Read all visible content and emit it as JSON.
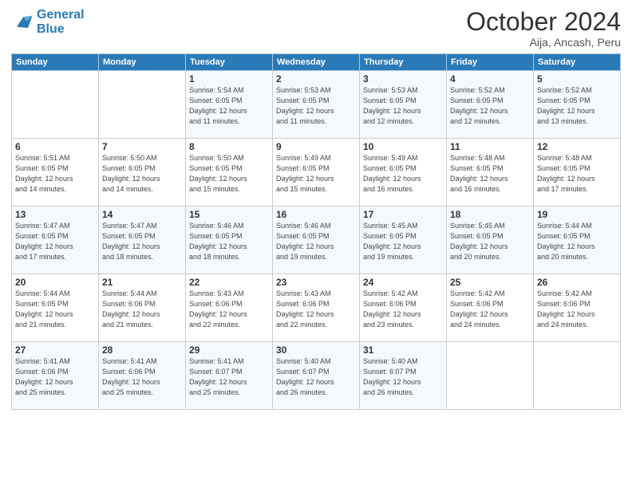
{
  "logo": {
    "line1": "General",
    "line2": "Blue"
  },
  "title": "October 2024",
  "subtitle": "Aija, Ancash, Peru",
  "days_of_week": [
    "Sunday",
    "Monday",
    "Tuesday",
    "Wednesday",
    "Thursday",
    "Friday",
    "Saturday"
  ],
  "weeks": [
    [
      {
        "num": "",
        "detail": ""
      },
      {
        "num": "",
        "detail": ""
      },
      {
        "num": "1",
        "detail": "Sunrise: 5:54 AM\nSunset: 6:05 PM\nDaylight: 12 hours\nand 11 minutes."
      },
      {
        "num": "2",
        "detail": "Sunrise: 5:53 AM\nSunset: 6:05 PM\nDaylight: 12 hours\nand 11 minutes."
      },
      {
        "num": "3",
        "detail": "Sunrise: 5:53 AM\nSunset: 6:05 PM\nDaylight: 12 hours\nand 12 minutes."
      },
      {
        "num": "4",
        "detail": "Sunrise: 5:52 AM\nSunset: 6:05 PM\nDaylight: 12 hours\nand 12 minutes."
      },
      {
        "num": "5",
        "detail": "Sunrise: 5:52 AM\nSunset: 6:05 PM\nDaylight: 12 hours\nand 13 minutes."
      }
    ],
    [
      {
        "num": "6",
        "detail": "Sunrise: 5:51 AM\nSunset: 6:05 PM\nDaylight: 12 hours\nand 14 minutes."
      },
      {
        "num": "7",
        "detail": "Sunrise: 5:50 AM\nSunset: 6:05 PM\nDaylight: 12 hours\nand 14 minutes."
      },
      {
        "num": "8",
        "detail": "Sunrise: 5:50 AM\nSunset: 6:05 PM\nDaylight: 12 hours\nand 15 minutes."
      },
      {
        "num": "9",
        "detail": "Sunrise: 5:49 AM\nSunset: 6:05 PM\nDaylight: 12 hours\nand 15 minutes."
      },
      {
        "num": "10",
        "detail": "Sunrise: 5:49 AM\nSunset: 6:05 PM\nDaylight: 12 hours\nand 16 minutes."
      },
      {
        "num": "11",
        "detail": "Sunrise: 5:48 AM\nSunset: 6:05 PM\nDaylight: 12 hours\nand 16 minutes."
      },
      {
        "num": "12",
        "detail": "Sunrise: 5:48 AM\nSunset: 6:05 PM\nDaylight: 12 hours\nand 17 minutes."
      }
    ],
    [
      {
        "num": "13",
        "detail": "Sunrise: 5:47 AM\nSunset: 6:05 PM\nDaylight: 12 hours\nand 17 minutes."
      },
      {
        "num": "14",
        "detail": "Sunrise: 5:47 AM\nSunset: 6:05 PM\nDaylight: 12 hours\nand 18 minutes."
      },
      {
        "num": "15",
        "detail": "Sunrise: 5:46 AM\nSunset: 6:05 PM\nDaylight: 12 hours\nand 18 minutes."
      },
      {
        "num": "16",
        "detail": "Sunrise: 5:46 AM\nSunset: 6:05 PM\nDaylight: 12 hours\nand 19 minutes."
      },
      {
        "num": "17",
        "detail": "Sunrise: 5:45 AM\nSunset: 6:05 PM\nDaylight: 12 hours\nand 19 minutes."
      },
      {
        "num": "18",
        "detail": "Sunrise: 5:45 AM\nSunset: 6:05 PM\nDaylight: 12 hours\nand 20 minutes."
      },
      {
        "num": "19",
        "detail": "Sunrise: 5:44 AM\nSunset: 6:05 PM\nDaylight: 12 hours\nand 20 minutes."
      }
    ],
    [
      {
        "num": "20",
        "detail": "Sunrise: 5:44 AM\nSunset: 6:05 PM\nDaylight: 12 hours\nand 21 minutes."
      },
      {
        "num": "21",
        "detail": "Sunrise: 5:44 AM\nSunset: 6:06 PM\nDaylight: 12 hours\nand 21 minutes."
      },
      {
        "num": "22",
        "detail": "Sunrise: 5:43 AM\nSunset: 6:06 PM\nDaylight: 12 hours\nand 22 minutes."
      },
      {
        "num": "23",
        "detail": "Sunrise: 5:43 AM\nSunset: 6:06 PM\nDaylight: 12 hours\nand 22 minutes."
      },
      {
        "num": "24",
        "detail": "Sunrise: 5:42 AM\nSunset: 6:06 PM\nDaylight: 12 hours\nand 23 minutes."
      },
      {
        "num": "25",
        "detail": "Sunrise: 5:42 AM\nSunset: 6:06 PM\nDaylight: 12 hours\nand 24 minutes."
      },
      {
        "num": "26",
        "detail": "Sunrise: 5:42 AM\nSunset: 6:06 PM\nDaylight: 12 hours\nand 24 minutes."
      }
    ],
    [
      {
        "num": "27",
        "detail": "Sunrise: 5:41 AM\nSunset: 6:06 PM\nDaylight: 12 hours\nand 25 minutes."
      },
      {
        "num": "28",
        "detail": "Sunrise: 5:41 AM\nSunset: 6:06 PM\nDaylight: 12 hours\nand 25 minutes."
      },
      {
        "num": "29",
        "detail": "Sunrise: 5:41 AM\nSunset: 6:07 PM\nDaylight: 12 hours\nand 25 minutes."
      },
      {
        "num": "30",
        "detail": "Sunrise: 5:40 AM\nSunset: 6:07 PM\nDaylight: 12 hours\nand 26 minutes."
      },
      {
        "num": "31",
        "detail": "Sunrise: 5:40 AM\nSunset: 6:07 PM\nDaylight: 12 hours\nand 26 minutes."
      },
      {
        "num": "",
        "detail": ""
      },
      {
        "num": "",
        "detail": ""
      }
    ]
  ]
}
